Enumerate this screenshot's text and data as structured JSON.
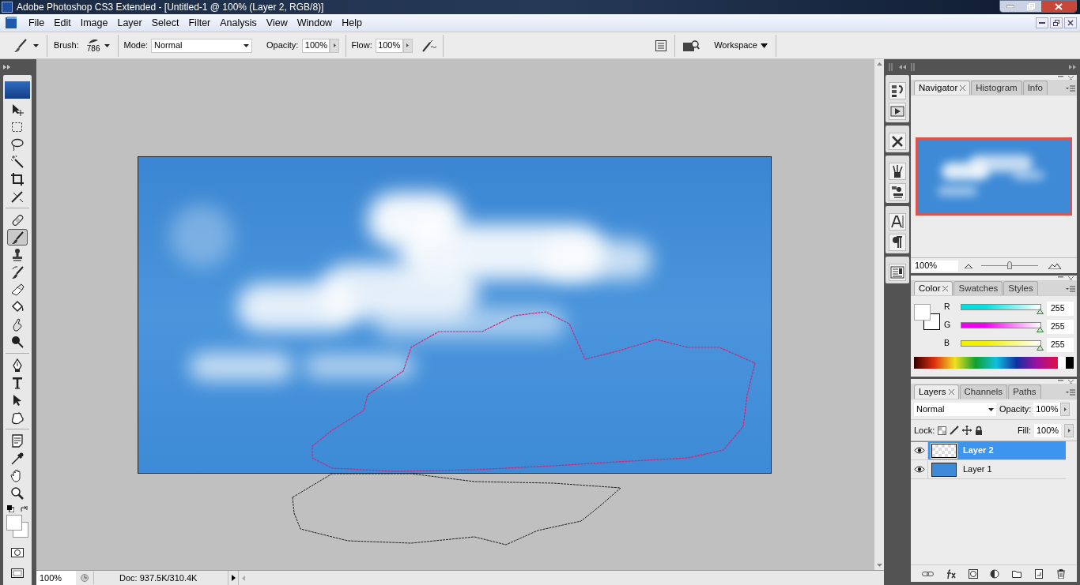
{
  "window": {
    "title": "Adobe Photoshop CS3 Extended - [Untitled-1 @ 100% (Layer 2, RGB/8)]"
  },
  "menu": [
    "File",
    "Edit",
    "Image",
    "Layer",
    "Select",
    "Filter",
    "Analysis",
    "View",
    "Window",
    "Help"
  ],
  "options_bar": {
    "brush_label": "Brush:",
    "brush_size": "786",
    "mode_label": "Mode:",
    "mode": "Normal",
    "opacity_label": "Opacity:",
    "opacity": "100%",
    "flow_label": "Flow:",
    "flow": "100%",
    "workspace": "Workspace"
  },
  "tool_groups": [
    [
      {
        "kind": "move",
        "selected": false
      },
      {
        "kind": "marquee",
        "selected": false
      },
      {
        "kind": "lasso",
        "selected": false
      },
      {
        "kind": "wand",
        "selected": false
      },
      {
        "kind": "crop",
        "selected": false
      },
      {
        "kind": "slice",
        "selected": false
      }
    ],
    [
      {
        "kind": "bandage",
        "selected": false
      },
      {
        "kind": "brush",
        "selected": true
      },
      {
        "kind": "stamp",
        "selected": false
      },
      {
        "kind": "history",
        "selected": false
      },
      {
        "kind": "eraser",
        "selected": false
      },
      {
        "kind": "bucket",
        "selected": false
      },
      {
        "kind": "blur",
        "selected": false
      },
      {
        "kind": "dodge",
        "selected": false
      }
    ],
    [
      {
        "kind": "pen",
        "selected": false
      },
      {
        "kind": "type",
        "selected": false
      },
      {
        "kind": "select",
        "selected": false
      },
      {
        "kind": "shape",
        "selected": false
      }
    ],
    [
      {
        "kind": "notes",
        "selected": false
      },
      {
        "kind": "eyedropper",
        "selected": false
      },
      {
        "kind": "hand",
        "selected": false
      },
      {
        "kind": "zoom",
        "selected": false
      }
    ]
  ],
  "navigator": {
    "tabs": [
      {
        "label": "Navigator",
        "selected": true
      },
      {
        "label": "Histogram",
        "selected": false
      },
      {
        "label": "Info",
        "selected": false
      }
    ],
    "zoom": "100%",
    "level": 0.5
  },
  "color": {
    "tabs": [
      {
        "label": "Color",
        "selected": true
      },
      {
        "label": "Swatches",
        "selected": false
      },
      {
        "label": "Styles",
        "selected": false
      }
    ],
    "channels": [
      {
        "name": "R",
        "value": "255",
        "level": 1,
        "color": "#00e0e0"
      },
      {
        "name": "G",
        "value": "255",
        "level": 1,
        "color": "#f000f0"
      },
      {
        "name": "B",
        "value": "255",
        "level": 1,
        "color": "#f0f000"
      }
    ]
  },
  "layers": {
    "tabs": [
      {
        "label": "Layers",
        "selected": true
      },
      {
        "label": "Channels",
        "selected": false
      },
      {
        "label": "Paths",
        "selected": false
      }
    ],
    "blend_mode": "Normal",
    "opacity_label": "Opacity:",
    "opacity": "100%",
    "lock_label": "Lock:",
    "fill_label": "Fill:",
    "fill": "100%",
    "items": [
      {
        "name": "Layer 2",
        "kind": "transparent",
        "selected": true,
        "visible": true
      },
      {
        "name": "Layer 1",
        "kind": "fill",
        "selected": false,
        "visible": true
      }
    ]
  },
  "status_bar": {
    "zoom": "100%",
    "doc": "Doc: 937.5K/310.4K"
  }
}
